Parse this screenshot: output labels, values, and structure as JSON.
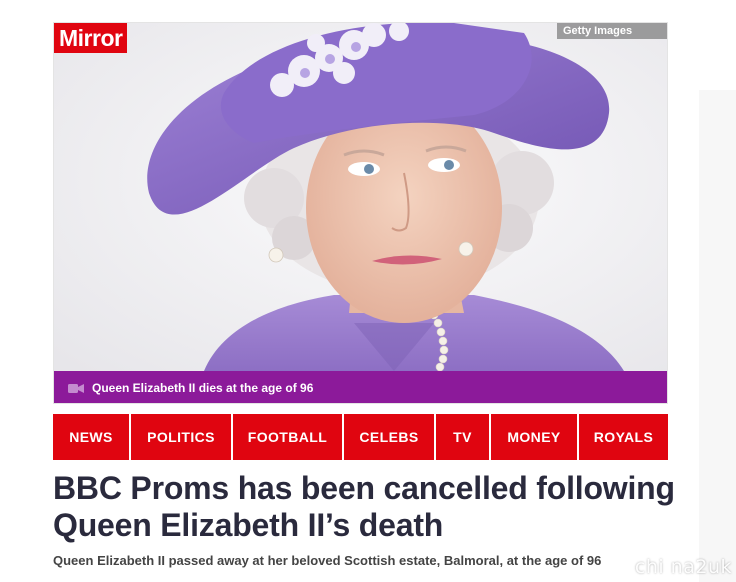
{
  "brand": {
    "logo_text": "Mirror",
    "accent_color": "#e00510",
    "video_bar_color": "#8c1a9a"
  },
  "hero": {
    "photo_credit": "Getty Images",
    "video_caption": "Queen Elizabeth II dies at the age of 96",
    "video_icon": "video-camera-icon"
  },
  "nav": {
    "items": [
      {
        "label": "NEWS"
      },
      {
        "label": "POLITICS"
      },
      {
        "label": "FOOTBALL"
      },
      {
        "label": "CELEBS"
      },
      {
        "label": "TV"
      },
      {
        "label": "MONEY"
      },
      {
        "label": "ROYALS"
      }
    ]
  },
  "article": {
    "headline": "BBC Proms has been cancelled following Queen Elizabeth II’s death",
    "standfirst": "Queen Elizabeth II passed away at her beloved Scottish estate, Balmoral, at the age of 96"
  },
  "watermark": {
    "text": "chi na2uk"
  }
}
